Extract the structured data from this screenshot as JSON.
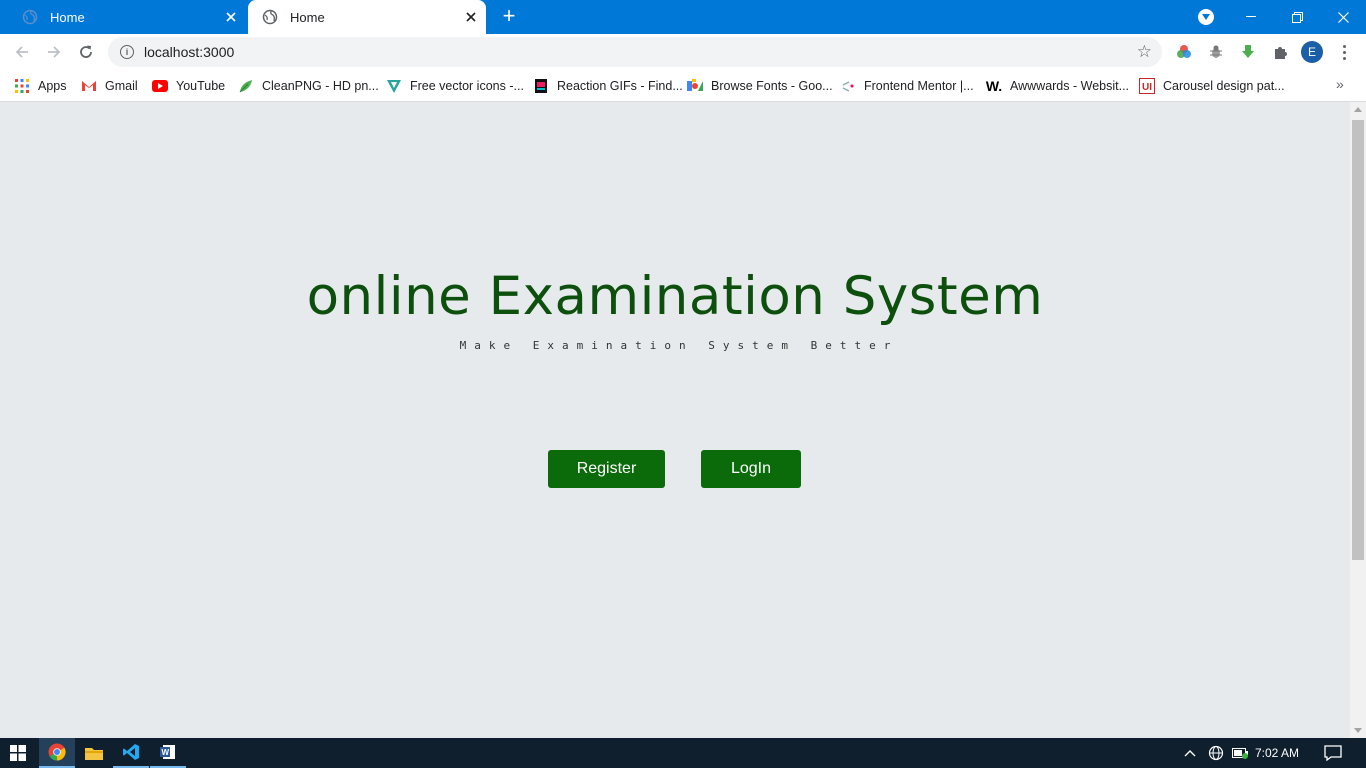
{
  "browser": {
    "tabs": [
      {
        "title": "Home",
        "active": false
      },
      {
        "title": "Home",
        "active": true
      }
    ],
    "new_tab_label": "+",
    "url": "localhost:3000",
    "profile_initial": "E",
    "bookmarks": [
      {
        "label": "Apps",
        "icon": "apps-grid-icon"
      },
      {
        "label": "Gmail",
        "icon": "gmail-icon"
      },
      {
        "label": "YouTube",
        "icon": "youtube-icon"
      },
      {
        "label": "CleanPNG - HD pn...",
        "icon": "cleanpng-icon"
      },
      {
        "label": "Free vector icons -...",
        "icon": "vector-icons-icon"
      },
      {
        "label": "Reaction GIFs - Find...",
        "icon": "reaction-gifs-icon"
      },
      {
        "label": "Browse Fonts - Goo...",
        "icon": "google-fonts-icon"
      },
      {
        "label": "Frontend Mentor |...",
        "icon": "frontend-mentor-icon"
      },
      {
        "label": "Awwwards - Websit...",
        "icon": "awwwards-icon"
      },
      {
        "label": "Carousel design pat...",
        "icon": "ui-patterns-icon"
      }
    ],
    "bookmarks_more": "»"
  },
  "page": {
    "title": "online Examination System",
    "subtitle": "Make Examination System Better",
    "register_label": "Register",
    "login_label": "LogIn"
  },
  "taskbar": {
    "apps": [
      "windows-start-icon",
      "chrome-icon",
      "file-explorer-icon",
      "vscode-icon",
      "word-icon"
    ],
    "clock": "7:02 AM"
  },
  "colors": {
    "accent_tabstrip": "#0078d7",
    "title_green": "#0d4f0d",
    "button_green": "#0b6b0b",
    "page_bg": "#e7eaec",
    "taskbar_bg": "#0f1f2e"
  }
}
